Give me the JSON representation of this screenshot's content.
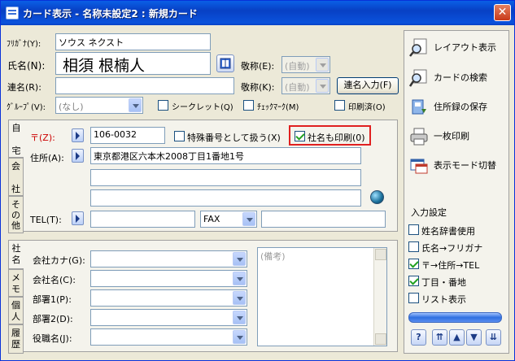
{
  "window": {
    "title": "カード表示 - 名称未設定2 : 新規カード",
    "close_glyph": "✕"
  },
  "form": {
    "furigana": {
      "label": "ﾌﾘｶﾞﾅ(Y):",
      "value": "ソウス ネクスト"
    },
    "name": {
      "label": "氏名(N):",
      "value": "相須 根楠人"
    },
    "honorific1": {
      "label": "敬称(E):",
      "value": "(自動)"
    },
    "renmei": {
      "label": "連名(R):",
      "value": ""
    },
    "honorific2": {
      "label": "敬称(K):",
      "value": "(自動)"
    },
    "renmei_button": "連名入力(F)",
    "group": {
      "label": "ｸﾞﾙｰﾌﾟ(V):",
      "value": "(なし)"
    },
    "secret": "シークレット(Q)",
    "checkmark": "ﾁｪｯｸﾏｰｸ(M)",
    "printed": "印刷済(O)"
  },
  "address": {
    "postal_label": "〒(Z):",
    "postal_value": "106-0032",
    "special_number": "特殊番号として扱う(X)",
    "print_company": "社名も印刷(0)",
    "addr_label": "住所(A):",
    "line1": "東京都港区六本木2008丁目1番地1号",
    "line2": "",
    "line3": "",
    "tel_label": "TEL(T):",
    "tel_value": "",
    "fax_type": "FAX",
    "fax_value": ""
  },
  "tabs_top": [
    "自",
    "宅",
    "会",
    "社",
    "そ",
    "の",
    "他"
  ],
  "tabs_bottom": [
    "社",
    "名",
    "メ",
    "モ",
    "個",
    "人",
    "履",
    "歴"
  ],
  "company": {
    "kana": "会社カナ(G):",
    "name": "会社名(C):",
    "dept1": "部署1(P):",
    "dept2": "部署2(D):",
    "title": "役職名(J):",
    "memo_placeholder": "(備考)"
  },
  "sidebar": {
    "layout": "レイアウト表示",
    "search": "カードの検索",
    "save": "住所録の保存",
    "print": "一枚印刷",
    "mode": "表示モード切替",
    "input_settings": "入力設定",
    "options": [
      {
        "label": "姓名辞書使用",
        "checked": false
      },
      {
        "label": "氏名→フリガナ",
        "checked": false
      },
      {
        "label": "〒→住所→TEL",
        "checked": true
      },
      {
        "label": "丁目・番地",
        "checked": true
      },
      {
        "label": "リスト表示",
        "checked": false
      }
    ]
  },
  "colors": {
    "highlight_border": "#e02020",
    "title_bar": "#0a5fe6"
  }
}
